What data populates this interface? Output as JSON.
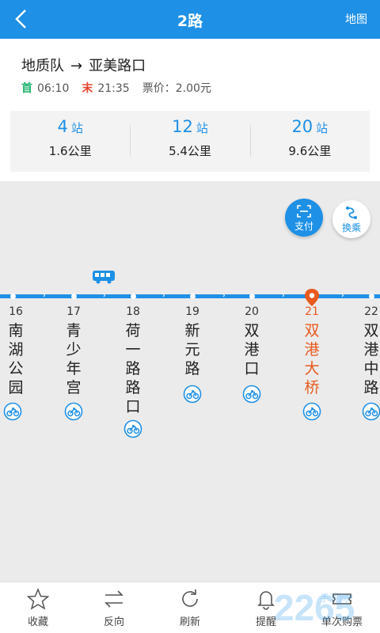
{
  "header": {
    "title": "2路",
    "map_label": "地图",
    "back_icon": "back-arrow-icon"
  },
  "route": {
    "from": "地质队",
    "arrow": "→",
    "to": "亚美路口"
  },
  "schedule": {
    "first_label": "首",
    "first_time": "06:10",
    "last_label": "末",
    "last_time": "21:35",
    "fare": "票价：2.00元"
  },
  "stats": [
    {
      "stops": "4",
      "unit": "站",
      "distance": "1.6公里"
    },
    {
      "stops": "12",
      "unit": "站",
      "distance": "5.4公里"
    },
    {
      "stops": "20",
      "unit": "站",
      "distance": "9.6公里"
    }
  ],
  "actions": {
    "pay_label": "支付",
    "transfer_label": "换乘"
  },
  "stations": [
    {
      "index": "16",
      "name": "南湖公园",
      "current": false
    },
    {
      "index": "17",
      "name": "青少年宫",
      "current": false
    },
    {
      "index": "18",
      "name": "荷一路路口",
      "current": false
    },
    {
      "index": "19",
      "name": "新元路",
      "current": false
    },
    {
      "index": "20",
      "name": "双港口",
      "current": false
    },
    {
      "index": "21",
      "name": "双港大桥",
      "current": true
    },
    {
      "index": "22",
      "name": "双港中路",
      "current": false
    }
  ],
  "tabs": [
    {
      "label": "收藏",
      "icon": "star-icon"
    },
    {
      "label": "反向",
      "icon": "swap-icon"
    },
    {
      "label": "刷新",
      "icon": "refresh-icon"
    },
    {
      "label": "提醒",
      "icon": "bell-icon"
    },
    {
      "label": "单次购票",
      "icon": "ticket-icon"
    }
  ],
  "colors": {
    "primary": "#1e90e6",
    "current_stop": "#e85a1d",
    "first": "#1eb36b",
    "last": "#e84530"
  },
  "watermark": "2265手游网"
}
